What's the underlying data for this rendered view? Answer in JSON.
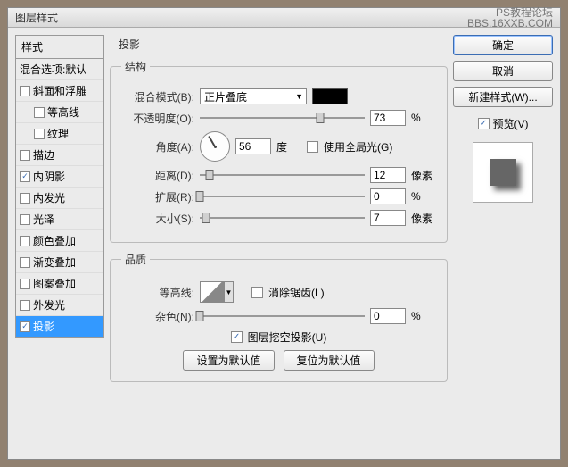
{
  "window": {
    "title": "图层样式",
    "watermark1": "PS教程论坛",
    "watermark2": "BBS.16XXB.COM"
  },
  "styles": {
    "header": "样式",
    "items": [
      {
        "label": "混合选项:默认",
        "checked": null
      },
      {
        "label": "斜面和浮雕",
        "checked": false
      },
      {
        "label": "等高线",
        "checked": false,
        "indent": true
      },
      {
        "label": "纹理",
        "checked": false,
        "indent": true
      },
      {
        "label": "描边",
        "checked": false
      },
      {
        "label": "内阴影",
        "checked": true
      },
      {
        "label": "内发光",
        "checked": false
      },
      {
        "label": "光泽",
        "checked": false
      },
      {
        "label": "颜色叠加",
        "checked": false
      },
      {
        "label": "渐变叠加",
        "checked": false
      },
      {
        "label": "图案叠加",
        "checked": false
      },
      {
        "label": "外发光",
        "checked": false
      },
      {
        "label": "投影",
        "checked": true,
        "selected": true
      }
    ]
  },
  "panel": {
    "title": "投影",
    "structure": {
      "legend": "结构",
      "blend_label": "混合模式(B):",
      "blend_value": "正片叠底",
      "color": "#000000",
      "opacity_label": "不透明度(O):",
      "opacity_value": "73",
      "opacity_unit": "%",
      "angle_label": "角度(A):",
      "angle_value": "56",
      "angle_unit": "度",
      "global_label": "使用全局光(G)",
      "global_checked": false,
      "distance_label": "距离(D):",
      "distance_value": "12",
      "distance_unit": "像素",
      "spread_label": "扩展(R):",
      "spread_value": "0",
      "spread_unit": "%",
      "size_label": "大小(S):",
      "size_value": "7",
      "size_unit": "像素"
    },
    "quality": {
      "legend": "品质",
      "contour_label": "等高线:",
      "antialias_label": "消除锯齿(L)",
      "antialias_checked": false,
      "noise_label": "杂色(N):",
      "noise_value": "0",
      "noise_unit": "%"
    },
    "knockout_label": "图层挖空投影(U)",
    "knockout_checked": true,
    "make_default": "设置为默认值",
    "reset_default": "复位为默认值"
  },
  "actions": {
    "ok": "确定",
    "cancel": "取消",
    "new_style": "新建样式(W)...",
    "preview_label": "预览(V)",
    "preview_checked": true
  }
}
